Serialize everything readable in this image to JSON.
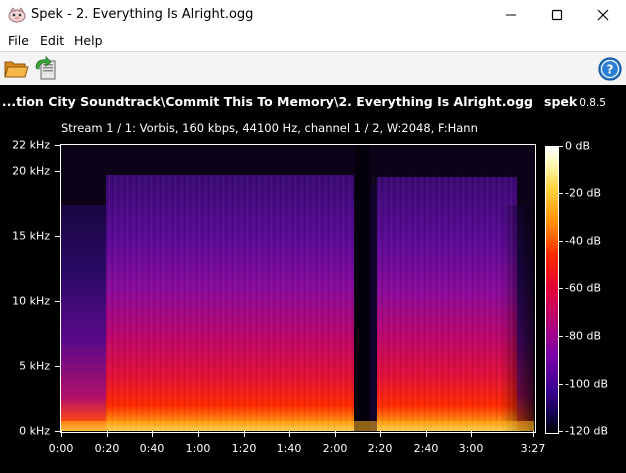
{
  "window": {
    "title": "Spek - 2. Everything Is Alright.ogg"
  },
  "menu": {
    "items": [
      "File",
      "Edit",
      "Help"
    ]
  },
  "toolbar": {
    "open_icon": "folder-open-icon",
    "save_icon": "save-export-icon",
    "help_icon": "help-icon"
  },
  "spectrogram": {
    "file_title": "...tion City Soundtrack\\Commit This To Memory\\2. Everything Is Alright.ogg",
    "logo": "spek",
    "version": "0.8.5",
    "stream_info": "Stream 1 / 1: Vorbis, 160 kbps, 44100 Hz, channel 1 / 2, W:2048, F:Hann",
    "freq_axis": [
      "22 kHz",
      "20 kHz",
      "15 kHz",
      "10 kHz",
      "5 kHz",
      "0 kHz"
    ],
    "time_axis": [
      "0:00",
      "0:20",
      "0:40",
      "1:00",
      "1:20",
      "1:40",
      "2:00",
      "2:20",
      "2:40",
      "3:00",
      "3:27"
    ],
    "db_scale": [
      "0 dB",
      "-20 dB",
      "-40 dB",
      "-60 dB",
      "-80 dB",
      "-100 dB",
      "-120 dB"
    ],
    "colors": {
      "background": "#000000",
      "high": "#ffffff",
      "mid": "#ff2a00",
      "low": "#3a0090"
    }
  }
}
